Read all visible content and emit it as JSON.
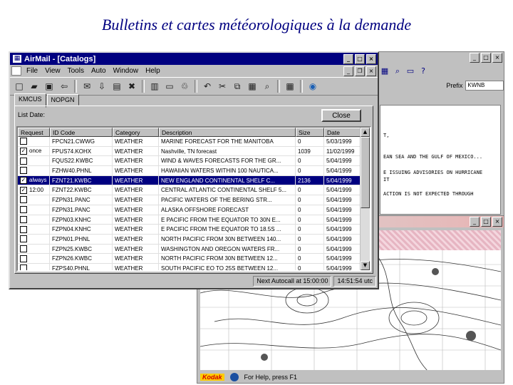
{
  "slide": {
    "title": "Bulletins et cartes météorologiques à la demande"
  },
  "airmail": {
    "window_title": "AirMail - [Catalogs]",
    "menu": [
      "File",
      "View",
      "Tools",
      "Auto",
      "Window",
      "Help"
    ],
    "tabs": [
      "KMCUS",
      "NOPGN"
    ],
    "list_date_label": "List Date:",
    "close_label": "Close",
    "columns": [
      "Request",
      "ID Code",
      "Category",
      "Description",
      "Size",
      "Date"
    ],
    "rows": [
      {
        "request": "",
        "checked": false,
        "id": "FPCN21.CWWG",
        "category": "WEATHER",
        "description": "MARINE FORECAST FOR THE MANITOBA",
        "size": "0",
        "date": "5/03/1999"
      },
      {
        "request": "once",
        "checked": true,
        "id": "FPUS74.KOHX",
        "category": "WEATHER",
        "description": "Nashville, TN forecast",
        "size": "1039",
        "date": "11/02/1999"
      },
      {
        "request": "",
        "checked": false,
        "id": "FQUS22.KWBC",
        "category": "WEATHER",
        "description": "WIND & WAVES FORECASTS FOR THE GR...",
        "size": "0",
        "date": "5/04/1999"
      },
      {
        "request": "",
        "checked": false,
        "id": "FZHW40.PHNL",
        "category": "WEATHER",
        "description": "HAWAIIAN WATERS WITHIN 100 NAUTICA...",
        "size": "0",
        "date": "5/04/1999"
      },
      {
        "request": "always",
        "checked": true,
        "id": "FZNT21.KWBC",
        "category": "WEATHER",
        "description": "NEW ENGLAND CONTINENTAL SHELF C...",
        "size": "2136",
        "date": "5/04/1999",
        "selected": true
      },
      {
        "request": "12:00",
        "checked": true,
        "id": "FZNT22.KWBC",
        "category": "WEATHER",
        "description": "CENTRAL ATLANTIC CONTINENTAL SHELF 5...",
        "size": "0",
        "date": "5/04/1999"
      },
      {
        "request": "",
        "checked": false,
        "id": "FZPN31.PANC",
        "category": "WEATHER",
        "description": "PACIFIC WATERS OF THE BERING STR...",
        "size": "0",
        "date": "5/04/1999"
      },
      {
        "request": "",
        "checked": false,
        "id": "FZPN31.PANC",
        "category": "WEATHER",
        "description": "ALASKA OFFSHORE FORECAST",
        "size": "0",
        "date": "5/04/1999"
      },
      {
        "request": "",
        "checked": false,
        "id": "FZPN03.KNHC",
        "category": "WEATHER",
        "description": "E PACIFIC FROM THE EQUATOR TO 30N E...",
        "size": "0",
        "date": "5/04/1999"
      },
      {
        "request": "",
        "checked": false,
        "id": "FZPN04.KNHC",
        "category": "WEATHER",
        "description": "E PACIFIC FROM THE EQUATOR TO 18.5S ...",
        "size": "0",
        "date": "5/04/1999"
      },
      {
        "request": "",
        "checked": false,
        "id": "FZPN01.PHNL",
        "category": "WEATHER",
        "description": "NORTH PACIFIC FROM 30N BETWEEN 140...",
        "size": "0",
        "date": "5/04/1999"
      },
      {
        "request": "",
        "checked": false,
        "id": "FZPN25.KWBC",
        "category": "WEATHER",
        "description": "WASHINGTON AND OREGON WATERS FR...",
        "size": "0",
        "date": "5/04/1999"
      },
      {
        "request": "",
        "checked": false,
        "id": "FZPN26.KWBC",
        "category": "WEATHER",
        "description": "NORTH PACIFIC FROM 30N BETWEEN 12...",
        "size": "0",
        "date": "5/04/1999"
      },
      {
        "request": "",
        "checked": false,
        "id": "FZPS40.PHNL",
        "category": "WEATHER",
        "description": "SOUTH PACIFIC EQ TO 25S BETWEEN 12...",
        "size": "0",
        "date": "5/04/1999"
      }
    ],
    "status": {
      "next_autocall": "Next Autocall at 15:00:00",
      "clock": "14:51:54 utc"
    }
  },
  "bulletin_window": {
    "field_label": "Prefix",
    "field_value": "KWNB",
    "lines": [
      "T,",
      "EAN SEA AND THE GULF OF MEXICO...",
      "E ISSUING ADVISORIES ON HURRICANE",
      "IT",
      "ACTION IS NOT EXPECTED THROUGH"
    ]
  },
  "map_window": {
    "brand": "Kodak",
    "status_text": "For Help, press F1"
  }
}
